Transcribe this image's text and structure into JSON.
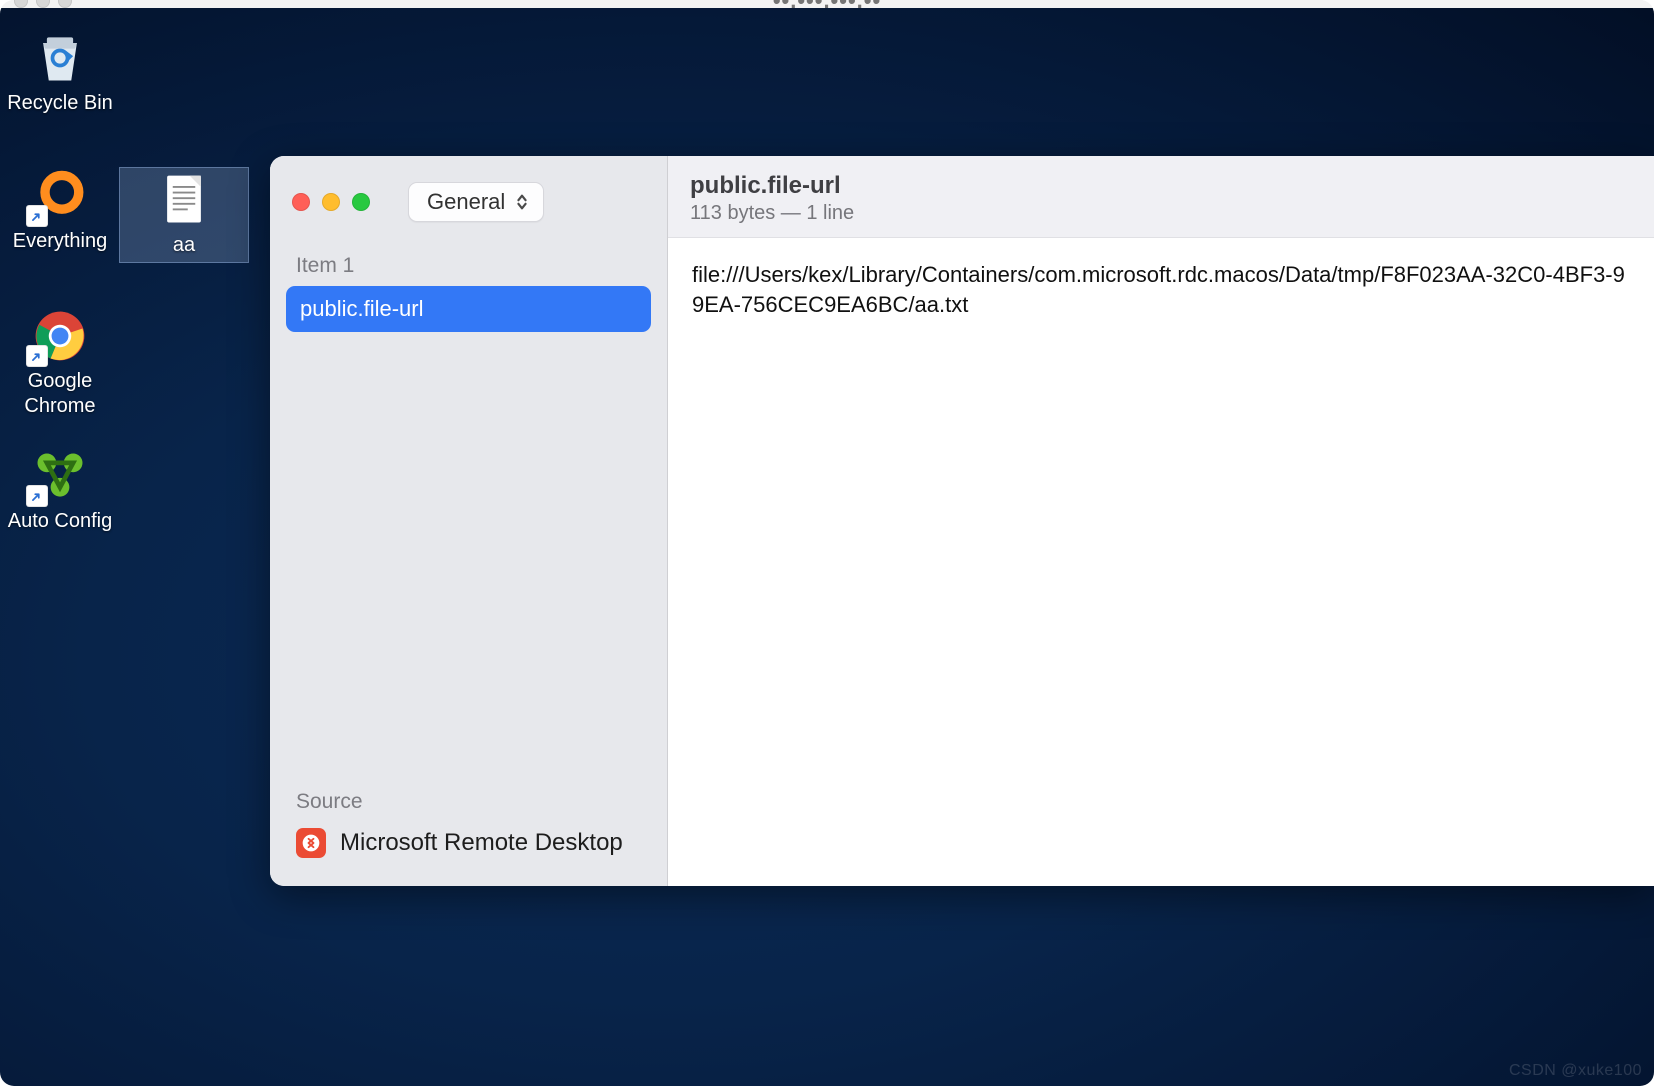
{
  "outer_window": {
    "title_obscured": "••.•••.•••.••"
  },
  "desktop": {
    "icons": {
      "recycle_bin": "Recycle Bin",
      "everything": "Everything",
      "aa_file": "aa",
      "chrome": "Google\nChrome",
      "auto_config": "Auto Config"
    }
  },
  "clip": {
    "dropdown_label": "General",
    "item_header": "Item 1",
    "items": [
      {
        "label": "public.file-url",
        "selected": true
      }
    ],
    "source": {
      "header": "Source",
      "app_name": "Microsoft Remote Desktop"
    },
    "detail": {
      "title": "public.file-url",
      "meta": "113 bytes — 1 line",
      "content": "file:///Users/kex/Library/Containers/com.microsoft.rdc.macos/Data/tmp/F8F023AA-32C0-4BF3-99EA-756CEC9EA6BC/aa.txt"
    }
  },
  "watermark": "CSDN @xuke100"
}
